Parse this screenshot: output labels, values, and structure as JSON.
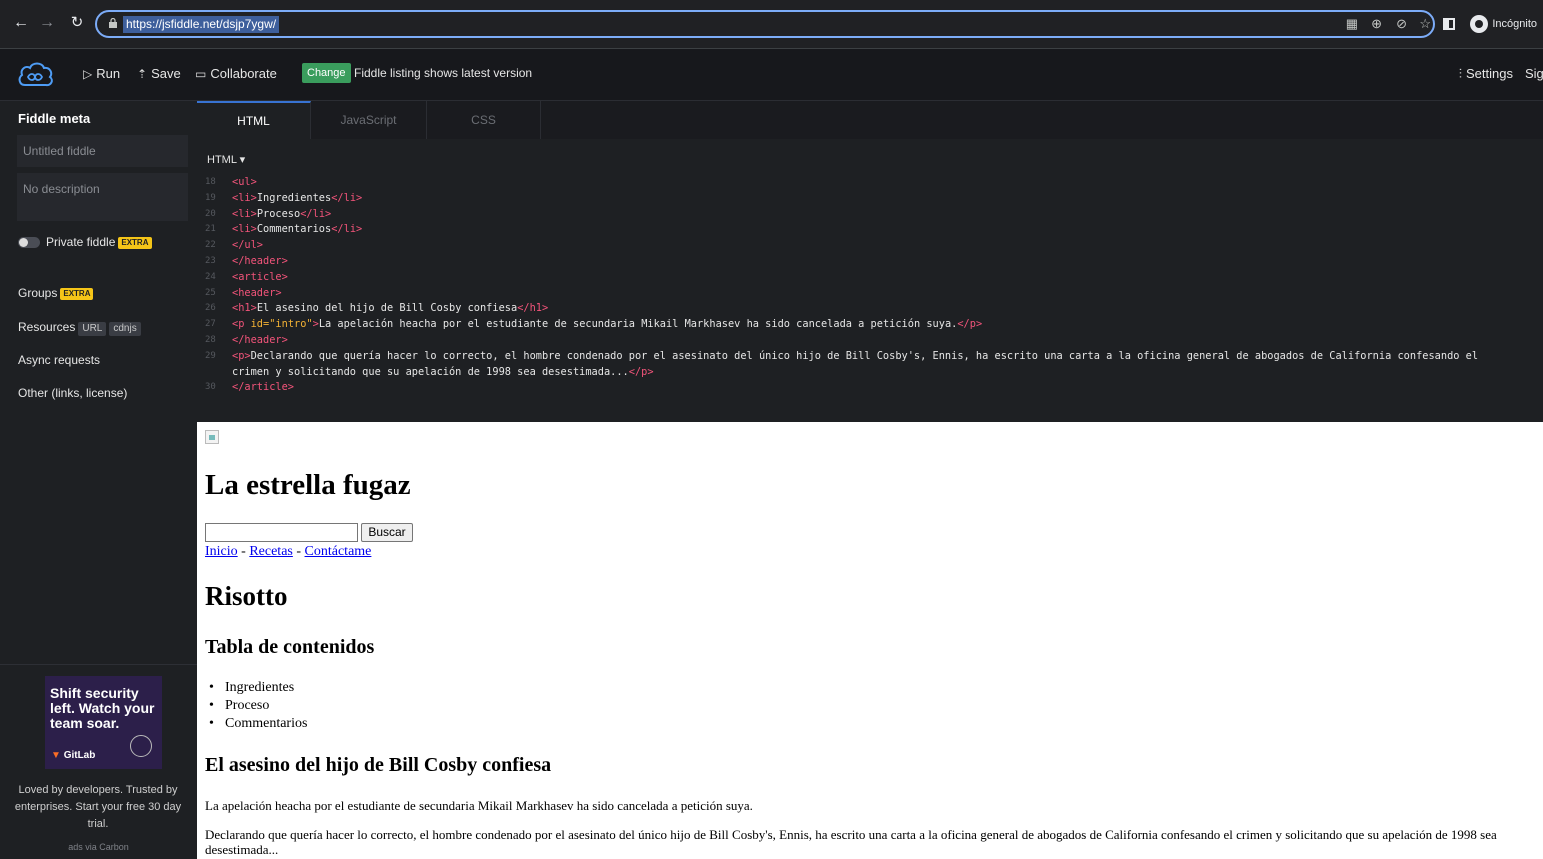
{
  "browser": {
    "url": "https://jsfiddle.net/dsjp7ygw/",
    "incognito_label": "Incógnito"
  },
  "header": {
    "run_label": "Run",
    "save_label": "Save",
    "collaborate_label": "Collaborate",
    "change_badge": "Change",
    "listing_text": "Fiddle listing shows latest version",
    "settings_label": "Settings",
    "signin_label": "Sign in"
  },
  "sidebar": {
    "title": "Fiddle meta",
    "title_placeholder": "Untitled fiddle",
    "description_placeholder": "No description",
    "private_label": "Private fiddle",
    "extra_badge": "EXTRA",
    "groups_label": "Groups",
    "resources_label": "Resources",
    "resources_tags": [
      "URL",
      "cdnjs"
    ],
    "async_label": "Async requests",
    "other_label": "Other (links, license)",
    "ad": {
      "headline": "Shift security left. Watch your team soar.",
      "brand": "GitLab",
      "text": "Loved by developers. Trusted by enterprises. Start your free 30 day trial.",
      "via": "ads via Carbon"
    }
  },
  "editor": {
    "tabs": [
      "HTML",
      "JavaScript",
      "CSS"
    ],
    "active_tab": "HTML",
    "language_select": "HTML",
    "lines": [
      {
        "n": "18",
        "html": "<span class=\"tg\">&lt;ul&gt;</span>"
      },
      {
        "n": "19",
        "html": "<span class=\"tg\">&lt;li&gt;</span>Ingredientes<span class=\"tg\">&lt;/li&gt;</span>"
      },
      {
        "n": "20",
        "html": "<span class=\"tg\">&lt;li&gt;</span>Proceso<span class=\"tg\">&lt;/li&gt;</span>"
      },
      {
        "n": "21",
        "html": "<span class=\"tg\">&lt;li&gt;</span>Commentarios<span class=\"tg\">&lt;/li&gt;</span>"
      },
      {
        "n": "22",
        "html": "<span class=\"tg\">&lt;/ul&gt;</span>"
      },
      {
        "n": "23",
        "html": "<span class=\"tg\">&lt;/header&gt;</span>"
      },
      {
        "n": "24",
        "html": "<span class=\"tg\">&lt;article&gt;</span>"
      },
      {
        "n": "25",
        "html": "<span class=\"tg\">&lt;header&gt;</span>"
      },
      {
        "n": "26",
        "html": "<span class=\"tg\">&lt;h1&gt;</span>El asesino del hijo de Bill Cosby confiesa<span class=\"tg\">&lt;/h1&gt;</span>"
      },
      {
        "n": "27",
        "html": "<span class=\"tg\">&lt;p </span><span class=\"at\">id=</span><span class=\"st\">\"intro\"</span><span class=\"tg\">&gt;</span>La apelación heacha por el estudiante de secundaria Mikail Markhasev ha sido cancelada a petición suya.<span class=\"tg\">&lt;/p&gt;</span>"
      },
      {
        "n": "28",
        "html": "<span class=\"tg\">&lt;/header&gt;</span>"
      },
      {
        "n": "29",
        "html": "<span class=\"tg\">&lt;p&gt;</span>Declarando que quería hacer lo correcto, el hombre condenado por el asesinato del único hijo de Bill Cosby's, Ennis, ha escrito una carta a la oficina general de abogados de California confesando el\ncrimen y solicitando que su apelación de 1998 sea desestimada...<span class=\"tg\">&lt;/p&gt;</span>",
        "tall": true
      },
      {
        "n": "30",
        "html": "<span class=\"tg\">&lt;/article&gt;</span>"
      }
    ]
  },
  "result": {
    "site_title": "La estrella fugaz",
    "search_button": "Buscar",
    "nav": [
      "Inicio",
      "Recetas",
      "Contáctame"
    ],
    "nav_separator": " - ",
    "recipe_title": "Risotto",
    "toc_title": "Tabla de contenidos",
    "toc_items": [
      "Ingredientes",
      "Proceso",
      "Commentarios"
    ],
    "article_title": "El asesino del hijo de Bill Cosby confiesa",
    "intro": "La apelación heacha por el estudiante de secundaria Mikail Markhasev ha sido cancelada a petición suya.",
    "body": "Declarando que quería hacer lo correcto, el hombre condenado por el asesinato del único hijo de Bill Cosby's, Ennis, ha escrito una carta a la oficina general de abogados de California confesando el crimen y solicitando que su apelación de 1998 sea desestimada..."
  }
}
